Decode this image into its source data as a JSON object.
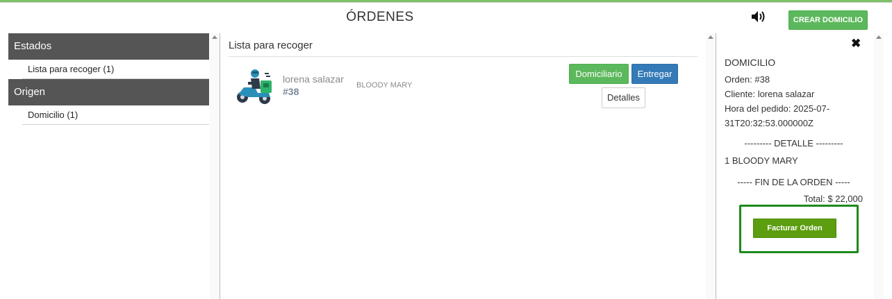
{
  "header": {
    "title": "ÓRDENES",
    "sound_icon": "speaker-volume-icon",
    "create_button": "CREAR DOMICILIO"
  },
  "sidebar": {
    "groups": [
      {
        "title": "Estados",
        "items": [
          {
            "label": "Lista para recoger (1)"
          }
        ]
      },
      {
        "title": "Origen",
        "items": [
          {
            "label": "Domicilio (1)"
          }
        ]
      }
    ]
  },
  "main": {
    "title": "Lista para recoger",
    "order": {
      "icon": "delivery-scooter-icon",
      "customer": "lorena salazar",
      "number": "#38",
      "product": "BLOODY MARY",
      "buttons": {
        "domiciliario": "Domiciliario",
        "entregar": "Entregar",
        "detalles": "Detalles"
      }
    }
  },
  "detail": {
    "close_icon": "close-x-icon",
    "title": "DOMICILIO",
    "order_line": "Orden: #38",
    "client_line": "Cliente: lorena salazar",
    "time_line": "Hora del pedido: 2025-07-31T20:32:53.000000Z",
    "detail_separator": "--------- DETALLE ---------",
    "item_line": "1  BLOODY MARY",
    "end_separator": "----- FIN DE LA ORDEN -----",
    "total": "Total: $ 22,000",
    "invoice_button": "Facturar Orden"
  },
  "colors": {
    "success_green": "#5cb85c",
    "primary_blue": "#337ab7",
    "sidebar_header": "#555555",
    "invoice_green": "#5c9e0f",
    "highlight_border": "#1c8a1c"
  }
}
